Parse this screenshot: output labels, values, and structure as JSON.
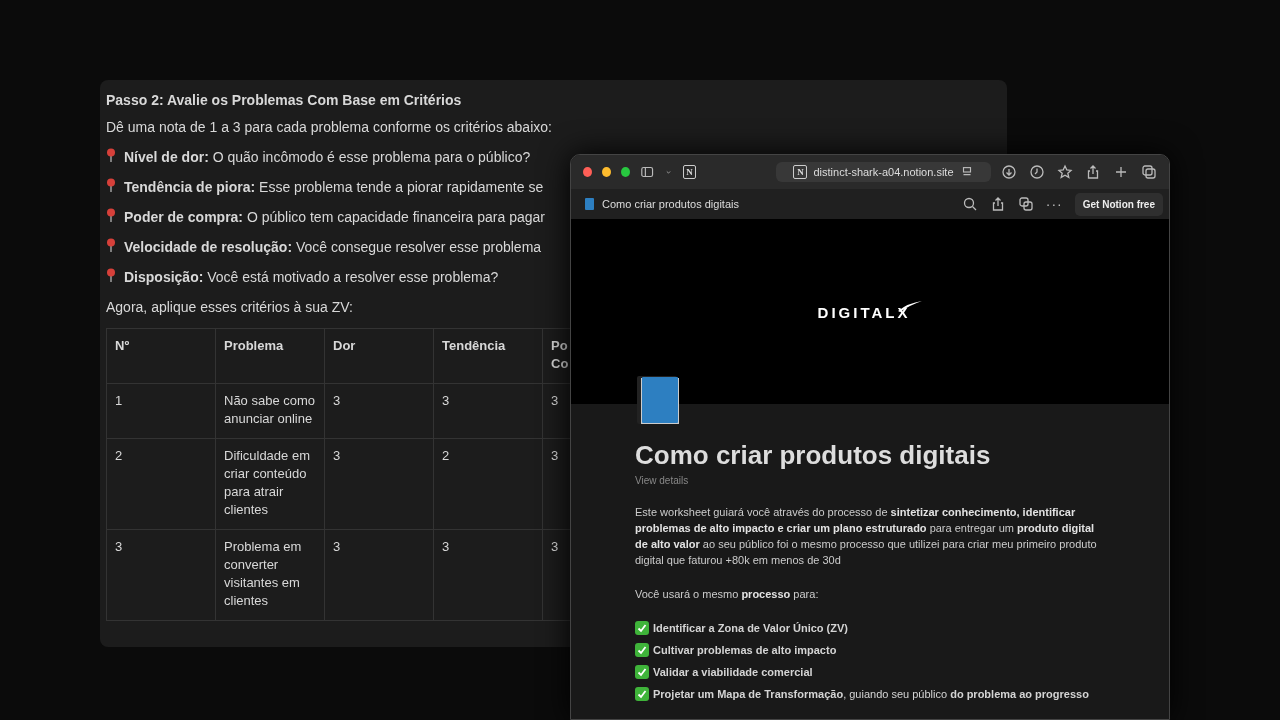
{
  "document": {
    "heading": "Passo 2: Avalie os Problemas Com Base em Critérios",
    "intro": "Dê uma nota de 1 a 3 para cada problema conforme os critérios abaixo:",
    "criteria": [
      {
        "label": "Nível de dor:",
        "text": "O quão incômodo é esse problema para o público?"
      },
      {
        "label": "Tendência de piora:",
        "text": "Esse problema tende a piorar rapidamente se"
      },
      {
        "label": "Poder de compra:",
        "text": "O público tem capacidade financeira para pagar"
      },
      {
        "label": "Velocidade de resolução:",
        "text": "Você consegue resolver esse problema"
      },
      {
        "label": "Disposição:",
        "text": "Você está motivado a resolver esse problema?"
      }
    ],
    "outro": "Agora, aplique esses critérios à sua ZV:",
    "table": {
      "columns": [
        "Nº",
        "Problema",
        "Dor",
        "Tendência",
        "Po Co"
      ],
      "rows": [
        [
          "1",
          "Não sabe como anunciar online",
          "3",
          "3",
          "3"
        ],
        [
          "2",
          "Dificuldade em criar conteúdo para atrair clientes",
          "3",
          "2",
          "3"
        ],
        [
          "3",
          "Problema em converter visitantes em clientes",
          "3",
          "3",
          "3"
        ]
      ]
    }
  },
  "browser": {
    "toolbar_logo": "N",
    "url_logo": "N",
    "url": "distinct-shark-a04.notion.site",
    "tab_title": "Como criar produtos digitais",
    "more": "···",
    "cta": "Get Notion free",
    "cover_logo": "DIGITALX",
    "page": {
      "title": "Como criar produtos digitais",
      "view_details": "View details",
      "paragraph": "Este worksheet guiará você através do processo de **sintetizar conhecimento, identificar problemas de alto impacto e criar um plano estruturado** para entregar um **produto digital de alto valor** ao seu público foi o mesmo processo que utilizei para criar meu primeiro produto digital que faturou +80k em menos de 30d",
      "lead": "Você usará o mesmo **processo** para:",
      "checklist": [
        {
          "text": "**Identificar a Zona de Valor Único (ZV)**",
          "checked": true
        },
        {
          "text": "**Cultivar problemas de alto impacto**",
          "checked": true
        },
        {
          "text": "**Validar a viabilidade comercial**",
          "checked": true
        },
        {
          "text": "**Projetar um Mapa de Transformação**, guiando seu público **do problema ao progresso**",
          "checked": true
        }
      ]
    }
  }
}
